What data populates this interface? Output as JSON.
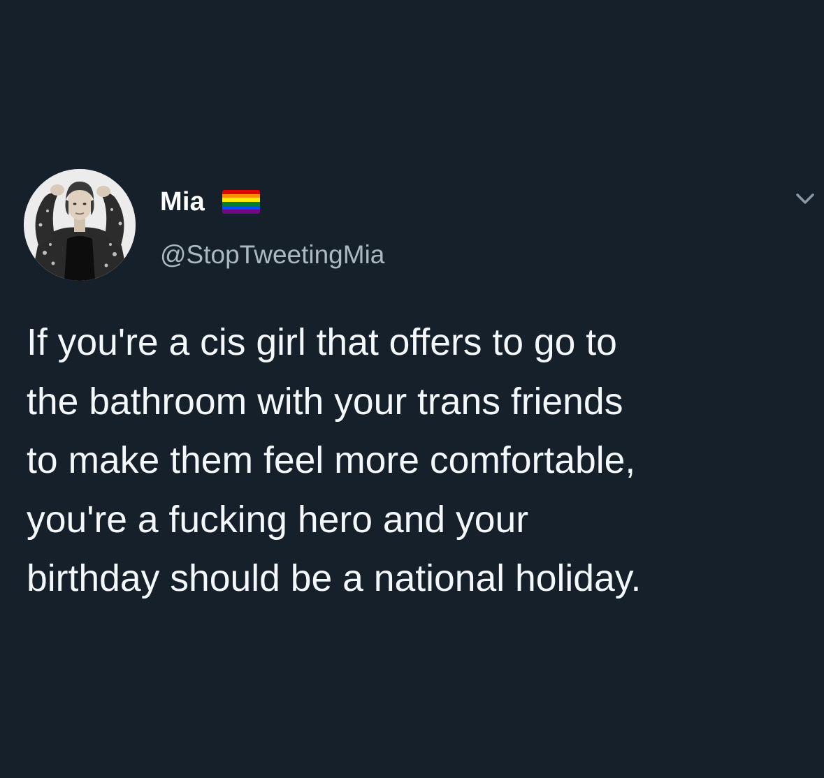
{
  "tweet": {
    "display_name": "Mia",
    "handle": "@StopTweetingMia",
    "text_lines": [
      "If you're a cis girl that offers to go to",
      "the bathroom with your trans friends",
      "to make them feel more comfortable,",
      "you're a fucking hero and your",
      "birthday should be a national holiday."
    ],
    "name_badge_icon": "rainbow-flag-icon",
    "menu_icon": "chevron-down-icon"
  },
  "colors": {
    "background": "#15202b",
    "name": "#ffffff",
    "handle": "#aab8c2",
    "text": "#f5f8fa",
    "caret": "#8899a6",
    "flag": [
      "#e40303",
      "#ff8c00",
      "#ffed00",
      "#008026",
      "#004dff",
      "#750787"
    ]
  }
}
